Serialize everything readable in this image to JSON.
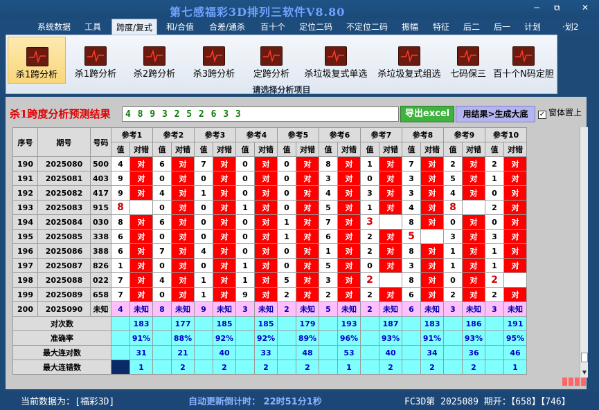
{
  "window": {
    "title": "第七感福彩3D排列三软件V8.80",
    "minimize": "−",
    "restore": "⧉",
    "close": "✕"
  },
  "menu": [
    "系统数据",
    "工具",
    "跨度/复式",
    "和/合值",
    "合差/通杀",
    "百十个",
    "定位二码",
    "不定位二码",
    "振幅",
    "特征",
    "后二",
    "后一",
    "计划",
    "·划2"
  ],
  "ribbon": {
    "items": [
      "杀1跨分析",
      "杀1跨分析",
      "杀2跨分析",
      "杀3跨分析",
      "定跨分析",
      "杀垃圾复式单选",
      "杀垃圾复式组选",
      "七码保三",
      "百十个N码定胆"
    ],
    "caption": "请选择分析项目"
  },
  "result": {
    "title": "杀1跨度分析预测结果",
    "value": "4 8 9 3 2 5 2 6 3 3",
    "excel_label": "导出excel",
    "gen_label": "用结果>生成大底",
    "topmost_label": "窗体置上",
    "topmost_check": "✓"
  },
  "table": {
    "head": {
      "seq": "序号",
      "issue": "期号",
      "num": "号码",
      "val": "值",
      "res": "对错"
    },
    "refs": [
      "参考1",
      "参考2",
      "参考3",
      "参考4",
      "参考5",
      "参考6",
      "参考7",
      "参考8",
      "参考9",
      "参考10"
    ],
    "correct": "对",
    "rows": [
      {
        "seq": "190",
        "issue": "2025080",
        "num": "500",
        "cells": [
          [
            "4",
            1
          ],
          [
            "6",
            1
          ],
          [
            "7",
            1
          ],
          [
            "0",
            1
          ],
          [
            "0",
            1
          ],
          [
            "8",
            1
          ],
          [
            "1",
            1
          ],
          [
            "7",
            1
          ],
          [
            "2",
            1
          ],
          [
            "2",
            1
          ]
        ]
      },
      {
        "seq": "191",
        "issue": "2025081",
        "num": "403",
        "cells": [
          [
            "9",
            1
          ],
          [
            "0",
            1
          ],
          [
            "0",
            1
          ],
          [
            "0",
            1
          ],
          [
            "0",
            1
          ],
          [
            "3",
            1
          ],
          [
            "0",
            1
          ],
          [
            "3",
            1
          ],
          [
            "5",
            1
          ],
          [
            "1",
            1
          ]
        ]
      },
      {
        "seq": "192",
        "issue": "2025082",
        "num": "417",
        "cells": [
          [
            "9",
            1
          ],
          [
            "4",
            1
          ],
          [
            "1",
            1
          ],
          [
            "0",
            1
          ],
          [
            "0",
            1
          ],
          [
            "4",
            1
          ],
          [
            "3",
            1
          ],
          [
            "3",
            1
          ],
          [
            "4",
            1
          ],
          [
            "0",
            1
          ]
        ]
      },
      {
        "seq": "193",
        "issue": "2025083",
        "num": "915",
        "cells": [
          [
            "8",
            0
          ],
          [
            "0",
            1
          ],
          [
            "0",
            1
          ],
          [
            "1",
            1
          ],
          [
            "0",
            1
          ],
          [
            "5",
            1
          ],
          [
            "1",
            1
          ],
          [
            "4",
            1
          ],
          [
            "8",
            0
          ],
          [
            "2",
            1
          ]
        ]
      },
      {
        "seq": "194",
        "issue": "2025084",
        "num": "030",
        "cells": [
          [
            "8",
            1
          ],
          [
            "6",
            1
          ],
          [
            "0",
            1
          ],
          [
            "0",
            1
          ],
          [
            "1",
            1
          ],
          [
            "7",
            1
          ],
          [
            "3",
            0
          ],
          [
            "8",
            1
          ],
          [
            "0",
            1
          ],
          [
            "0",
            1
          ]
        ]
      },
      {
        "seq": "195",
        "issue": "2025085",
        "num": "338",
        "cells": [
          [
            "6",
            1
          ],
          [
            "0",
            1
          ],
          [
            "0",
            1
          ],
          [
            "0",
            1
          ],
          [
            "1",
            1
          ],
          [
            "6",
            1
          ],
          [
            "2",
            1
          ],
          [
            "5",
            0
          ],
          [
            "3",
            1
          ],
          [
            "3",
            1
          ]
        ]
      },
      {
        "seq": "196",
        "issue": "2025086",
        "num": "388",
        "cells": [
          [
            "6",
            1
          ],
          [
            "7",
            1
          ],
          [
            "4",
            1
          ],
          [
            "0",
            1
          ],
          [
            "0",
            1
          ],
          [
            "1",
            1
          ],
          [
            "2",
            1
          ],
          [
            "8",
            1
          ],
          [
            "1",
            1
          ],
          [
            "1",
            1
          ]
        ]
      },
      {
        "seq": "197",
        "issue": "2025087",
        "num": "826",
        "cells": [
          [
            "1",
            1
          ],
          [
            "0",
            1
          ],
          [
            "0",
            1
          ],
          [
            "1",
            1
          ],
          [
            "0",
            1
          ],
          [
            "5",
            1
          ],
          [
            "0",
            1
          ],
          [
            "3",
            1
          ],
          [
            "1",
            1
          ],
          [
            "1",
            1
          ]
        ]
      },
      {
        "seq": "198",
        "issue": "2025088",
        "num": "022",
        "cells": [
          [
            "7",
            1
          ],
          [
            "4",
            1
          ],
          [
            "1",
            1
          ],
          [
            "1",
            1
          ],
          [
            "5",
            1
          ],
          [
            "3",
            1
          ],
          [
            "2",
            0
          ],
          [
            "8",
            1
          ],
          [
            "0",
            1
          ],
          [
            "2",
            0
          ]
        ]
      },
      {
        "seq": "199",
        "issue": "2025089",
        "num": "658",
        "cells": [
          [
            "7",
            1
          ],
          [
            "0",
            1
          ],
          [
            "1",
            1
          ],
          [
            "9",
            1
          ],
          [
            "2",
            1
          ],
          [
            "2",
            1
          ],
          [
            "2",
            1
          ],
          [
            "6",
            1
          ],
          [
            "2",
            1
          ],
          [
            "2",
            1
          ]
        ]
      }
    ],
    "unknown_row": {
      "seq": "200",
      "issue": "2025090",
      "num": "未知",
      "label": "未知",
      "values": [
        "4",
        "8",
        "9",
        "3",
        "2",
        "5",
        "2",
        "6",
        "3",
        "3"
      ]
    },
    "stats": [
      {
        "label": "对次数",
        "values": [
          "183",
          "177",
          "185",
          "185",
          "179",
          "193",
          "187",
          "183",
          "186",
          "191"
        ]
      },
      {
        "label": "准确率",
        "values": [
          "91%",
          "88%",
          "92%",
          "92%",
          "89%",
          "96%",
          "93%",
          "91%",
          "93%",
          "95%"
        ]
      },
      {
        "label": "最大连对数",
        "values": [
          "31",
          "21",
          "40",
          "33",
          "48",
          "53",
          "40",
          "34",
          "36",
          "46"
        ]
      },
      {
        "label": "最大连错数",
        "values": [
          "1",
          "2",
          "2",
          "2",
          "2",
          "1",
          "2",
          "2",
          "2",
          "1"
        ]
      }
    ]
  },
  "status": {
    "source": "当前数据为：[福彩3D]",
    "countdown": "自动更新倒计时：  22时51分1秒",
    "issue": "FC3D第 2025089 期开：【658】【746】"
  },
  "colors": {
    "correct": "#ff0000",
    "unknown_row": "#ffbfff",
    "stats_row": "#80ffff",
    "ribbon_active": "#f9d67a"
  }
}
